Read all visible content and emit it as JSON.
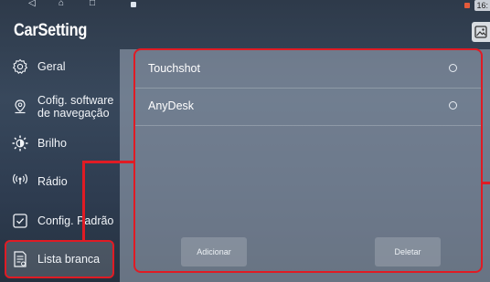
{
  "status_bar": {
    "back_glyph": "◁",
    "home_glyph": "⌂",
    "recents_glyph": "□",
    "right_text": "16:"
  },
  "app": {
    "title": "CarSetting"
  },
  "sidebar": {
    "items": [
      {
        "label": "Geral",
        "icon": "gear-icon"
      },
      {
        "label": "Cofig. software\nde navegação",
        "icon": "location-pin-icon"
      },
      {
        "label": "Brilho",
        "icon": "brightness-icon"
      },
      {
        "label": "Rádio",
        "icon": "radio-signal-icon"
      },
      {
        "label": "Config. Padrão",
        "icon": "checkbox-icon"
      },
      {
        "label": "Lista branca",
        "icon": "document-list-icon",
        "selected": true
      }
    ]
  },
  "whitelist": {
    "apps": [
      {
        "name": "Touchshot"
      },
      {
        "name": "AnyDesk"
      }
    ],
    "add_button": "Adicionar",
    "delete_button": "Deletar"
  },
  "colors": {
    "highlight": "#e01b24",
    "background": "#33425a"
  }
}
